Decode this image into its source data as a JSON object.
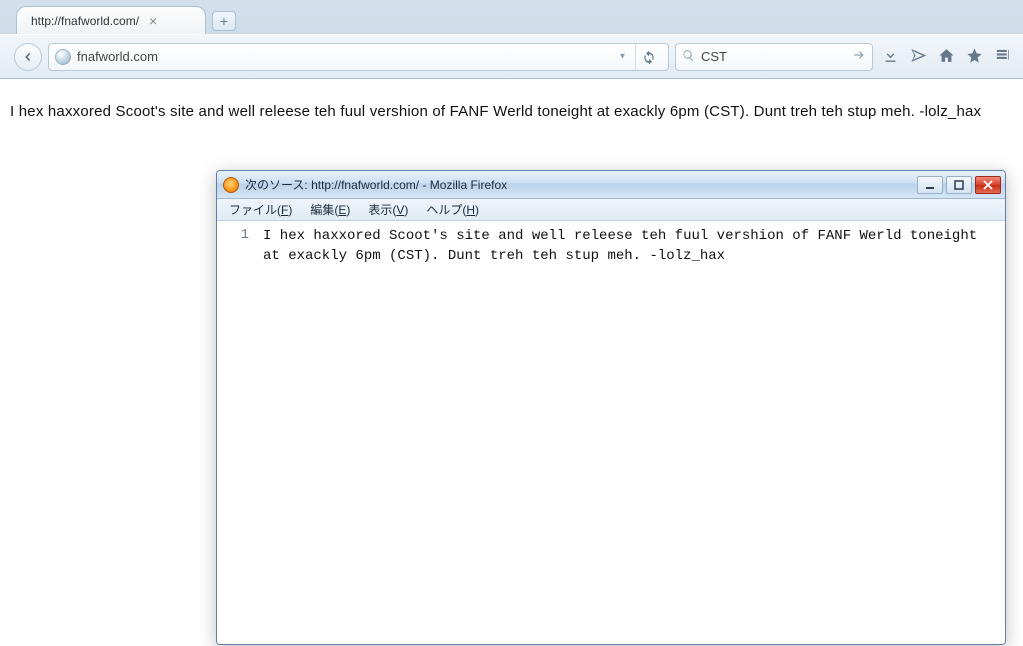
{
  "browser": {
    "tab_title": "http://fnafworld.com/",
    "url_display": "fnafworld.com",
    "search_value": "CST"
  },
  "page": {
    "body_text": "I hex haxxored Scoot's site and well releese teh fuul vershion of FANF Werld toneight at exackly 6pm (CST). Dunt treh teh stup meh. -lolz_hax"
  },
  "source_window": {
    "title": "次のソース: http://fnafworld.com/ - Mozilla Firefox",
    "menus": {
      "file": "ファイル(",
      "file_u": "F",
      "file2": ")",
      "edit": "編集(",
      "edit_u": "E",
      "edit2": ")",
      "view": "表示(",
      "view_u": "V",
      "view2": ")",
      "help": "ヘルプ(",
      "help_u": "H",
      "help2": ")"
    },
    "line_number": "1",
    "source_text": "I hex haxxored Scoot's site and well releese teh fuul vershion of FANF Werld toneight at exackly 6pm (CST). Dunt treh teh stup meh.  -lolz_hax"
  }
}
